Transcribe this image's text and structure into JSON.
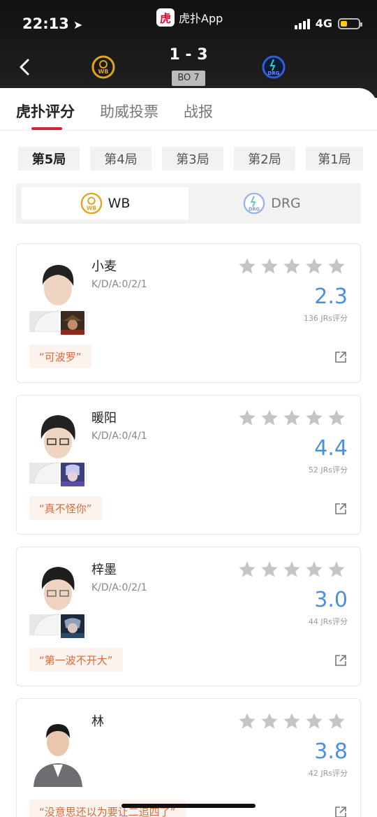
{
  "status": {
    "time": "22:13",
    "network": "4G"
  },
  "app": {
    "name": "虎扑App",
    "icon_glyph": "虎"
  },
  "match": {
    "score": "1 - 3",
    "format": "BO 7",
    "team_left_logo_text": "WB",
    "team_right_logo_text": "DRG"
  },
  "tabs": [
    {
      "label": "虎扑评分",
      "active": true
    },
    {
      "label": "助威投票",
      "active": false
    },
    {
      "label": "战报",
      "active": false
    }
  ],
  "rounds": [
    "第5局",
    "第4局",
    "第3局",
    "第2局",
    "第1局"
  ],
  "teams": [
    {
      "name": "WB",
      "active": true
    },
    {
      "name": "DRG",
      "active": false
    }
  ],
  "players": [
    {
      "name": "小麦",
      "kda": "K/D/A:0/2/1",
      "rating": "2.3",
      "votes": "136 JRs评分",
      "quote": "“可波罗”"
    },
    {
      "name": "暖阳",
      "kda": "K/D/A:0/4/1",
      "rating": "4.4",
      "votes": "52 JRs评分",
      "quote": "“真不怪你”"
    },
    {
      "name": "梓墨",
      "kda": "K/D/A:0/2/1",
      "rating": "3.0",
      "votes": "44 JRs评分",
      "quote": "“第一波不开大”"
    },
    {
      "name": "林",
      "kda": "",
      "rating": "3.8",
      "votes": "42 JRs评分",
      "quote": "“没意思还以为要让二追四了”"
    }
  ],
  "colors": {
    "accent": "#d0272d",
    "rating": "#4a90e2",
    "quote": "#d9683b"
  }
}
